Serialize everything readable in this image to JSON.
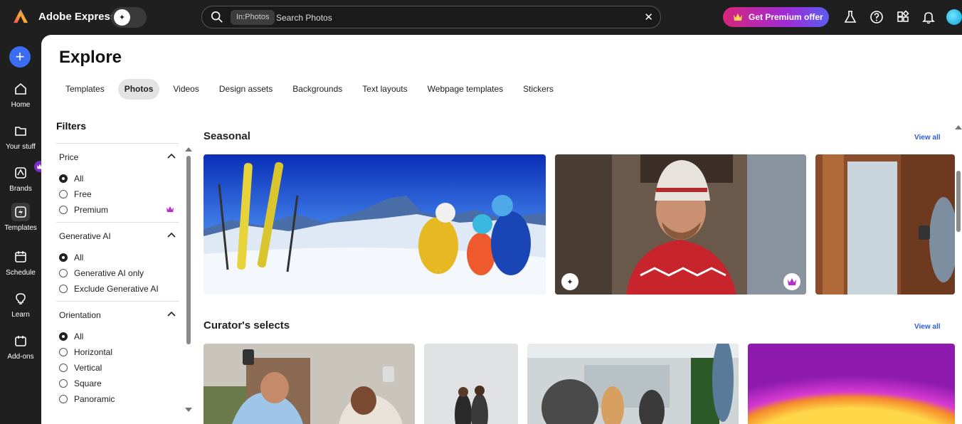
{
  "app": {
    "title": "Adobe Express"
  },
  "search": {
    "chip": "In:Photos",
    "placeholder": "Search Photos",
    "clear_icon": "close-icon"
  },
  "premium": {
    "label": "Get Premium offer"
  },
  "rail": {
    "items": [
      {
        "label": "Home",
        "icon": "home-icon"
      },
      {
        "label": "Your stuff",
        "icon": "folder-icon"
      },
      {
        "label": "Brands",
        "icon": "brand-icon"
      },
      {
        "label": "Templates",
        "icon": "templates-icon"
      },
      {
        "label": "Schedule",
        "icon": "calendar-icon"
      },
      {
        "label": "Learn",
        "icon": "lightbulb-icon"
      },
      {
        "label": "Add-ons",
        "icon": "addons-icon"
      }
    ]
  },
  "page": {
    "title": "Explore"
  },
  "tabs": [
    {
      "label": "Templates"
    },
    {
      "label": "Photos"
    },
    {
      "label": "Videos"
    },
    {
      "label": "Design assets"
    },
    {
      "label": "Backgrounds"
    },
    {
      "label": "Text layouts"
    },
    {
      "label": "Webpage templates"
    },
    {
      "label": "Stickers"
    }
  ],
  "filters": {
    "title": "Filters",
    "groups": [
      {
        "title": "Price",
        "options": [
          {
            "label": "All"
          },
          {
            "label": "Free"
          },
          {
            "label": "Premium"
          }
        ]
      },
      {
        "title": "Generative AI",
        "options": [
          {
            "label": "All"
          },
          {
            "label": "Generative AI only"
          },
          {
            "label": "Exclude Generative AI"
          }
        ]
      },
      {
        "title": "Orientation",
        "options": [
          {
            "label": "All"
          },
          {
            "label": "Horizontal"
          },
          {
            "label": "Vertical"
          },
          {
            "label": "Square"
          },
          {
            "label": "Panoramic"
          }
        ]
      }
    ]
  },
  "sections": [
    {
      "title": "Seasonal",
      "view_all": "View all"
    },
    {
      "title": "Curator's selects",
      "view_all": "View all"
    }
  ],
  "colors": {
    "accent": "#3a6cf4",
    "link": "#2d5bd8",
    "premium_start": "#d6267b",
    "premium_end": "#5b5cf0"
  }
}
